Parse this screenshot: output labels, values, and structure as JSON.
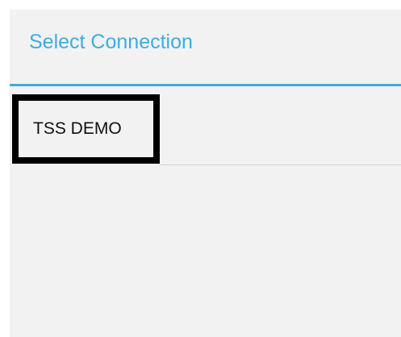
{
  "dialog": {
    "title": "Select Connection",
    "connections": [
      {
        "label": "TSS DEMO",
        "selected": true
      }
    ]
  },
  "colors": {
    "accent": "#3aaee0",
    "background": "#f2f2f2",
    "selection_border": "#000000"
  }
}
